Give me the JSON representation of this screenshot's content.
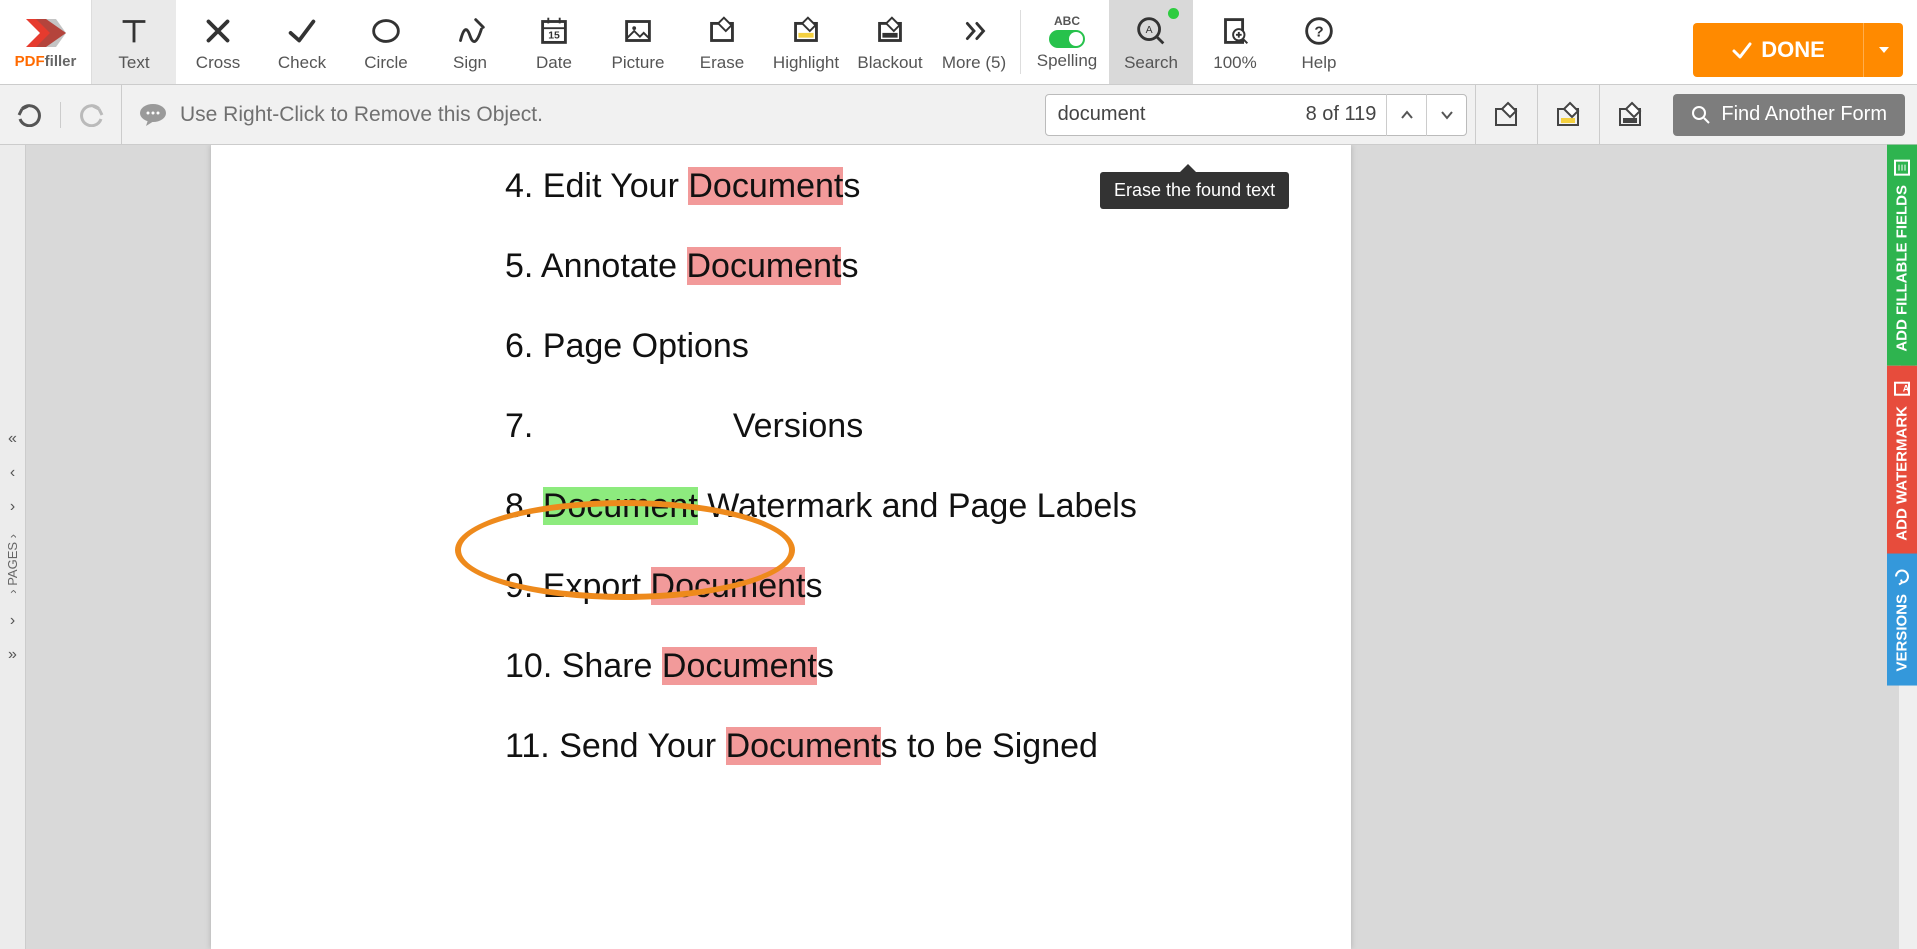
{
  "brand": {
    "pdf": "PDF",
    "filler": "filler"
  },
  "toolbar": {
    "text": "Text",
    "cross": "Cross",
    "check": "Check",
    "circle": "Circle",
    "sign": "Sign",
    "date": "Date",
    "picture": "Picture",
    "erase": "Erase",
    "highlight": "Highlight",
    "blackout": "Blackout",
    "more": "More (5)",
    "spelling_abc": "ABC",
    "spelling": "Spelling",
    "search": "Search",
    "zoom": "100%",
    "help": "Help",
    "done": "DONE"
  },
  "secondbar": {
    "hint": "Use Right-Click to Remove this Object.",
    "search_value": "document",
    "search_count": "8 of 119",
    "find_another": "Find Another Form",
    "tooltip": "Erase the found text"
  },
  "leftrail": {
    "pages": "PAGES"
  },
  "sidetabs": {
    "fields": "ADD FILLABLE FIELDS",
    "watermark": "ADD WATERMARK",
    "versions": "VERSIONS"
  },
  "doc": {
    "l4_a": "4. Edit Your ",
    "l4_b": "Document",
    "l4_c": "s",
    "l5_a": "5. Annotate ",
    "l5_b": "Document",
    "l5_c": "s",
    "l6": "6. Page Options",
    "l7_a": "7. ",
    "l7_b": "Versions",
    "l8_a": "8. ",
    "l8_b": "Document",
    "l8_c": " Watermark and Page Labels",
    "l9_a": "9. Export ",
    "l9_b": "Document",
    "l9_c": "s",
    "l10_a": "10. Share ",
    "l10_b": "Document",
    "l10_c": "s",
    "l11_a": "11. Send Your ",
    "l11_b": "Document",
    "l11_c": "s to be Signed"
  }
}
